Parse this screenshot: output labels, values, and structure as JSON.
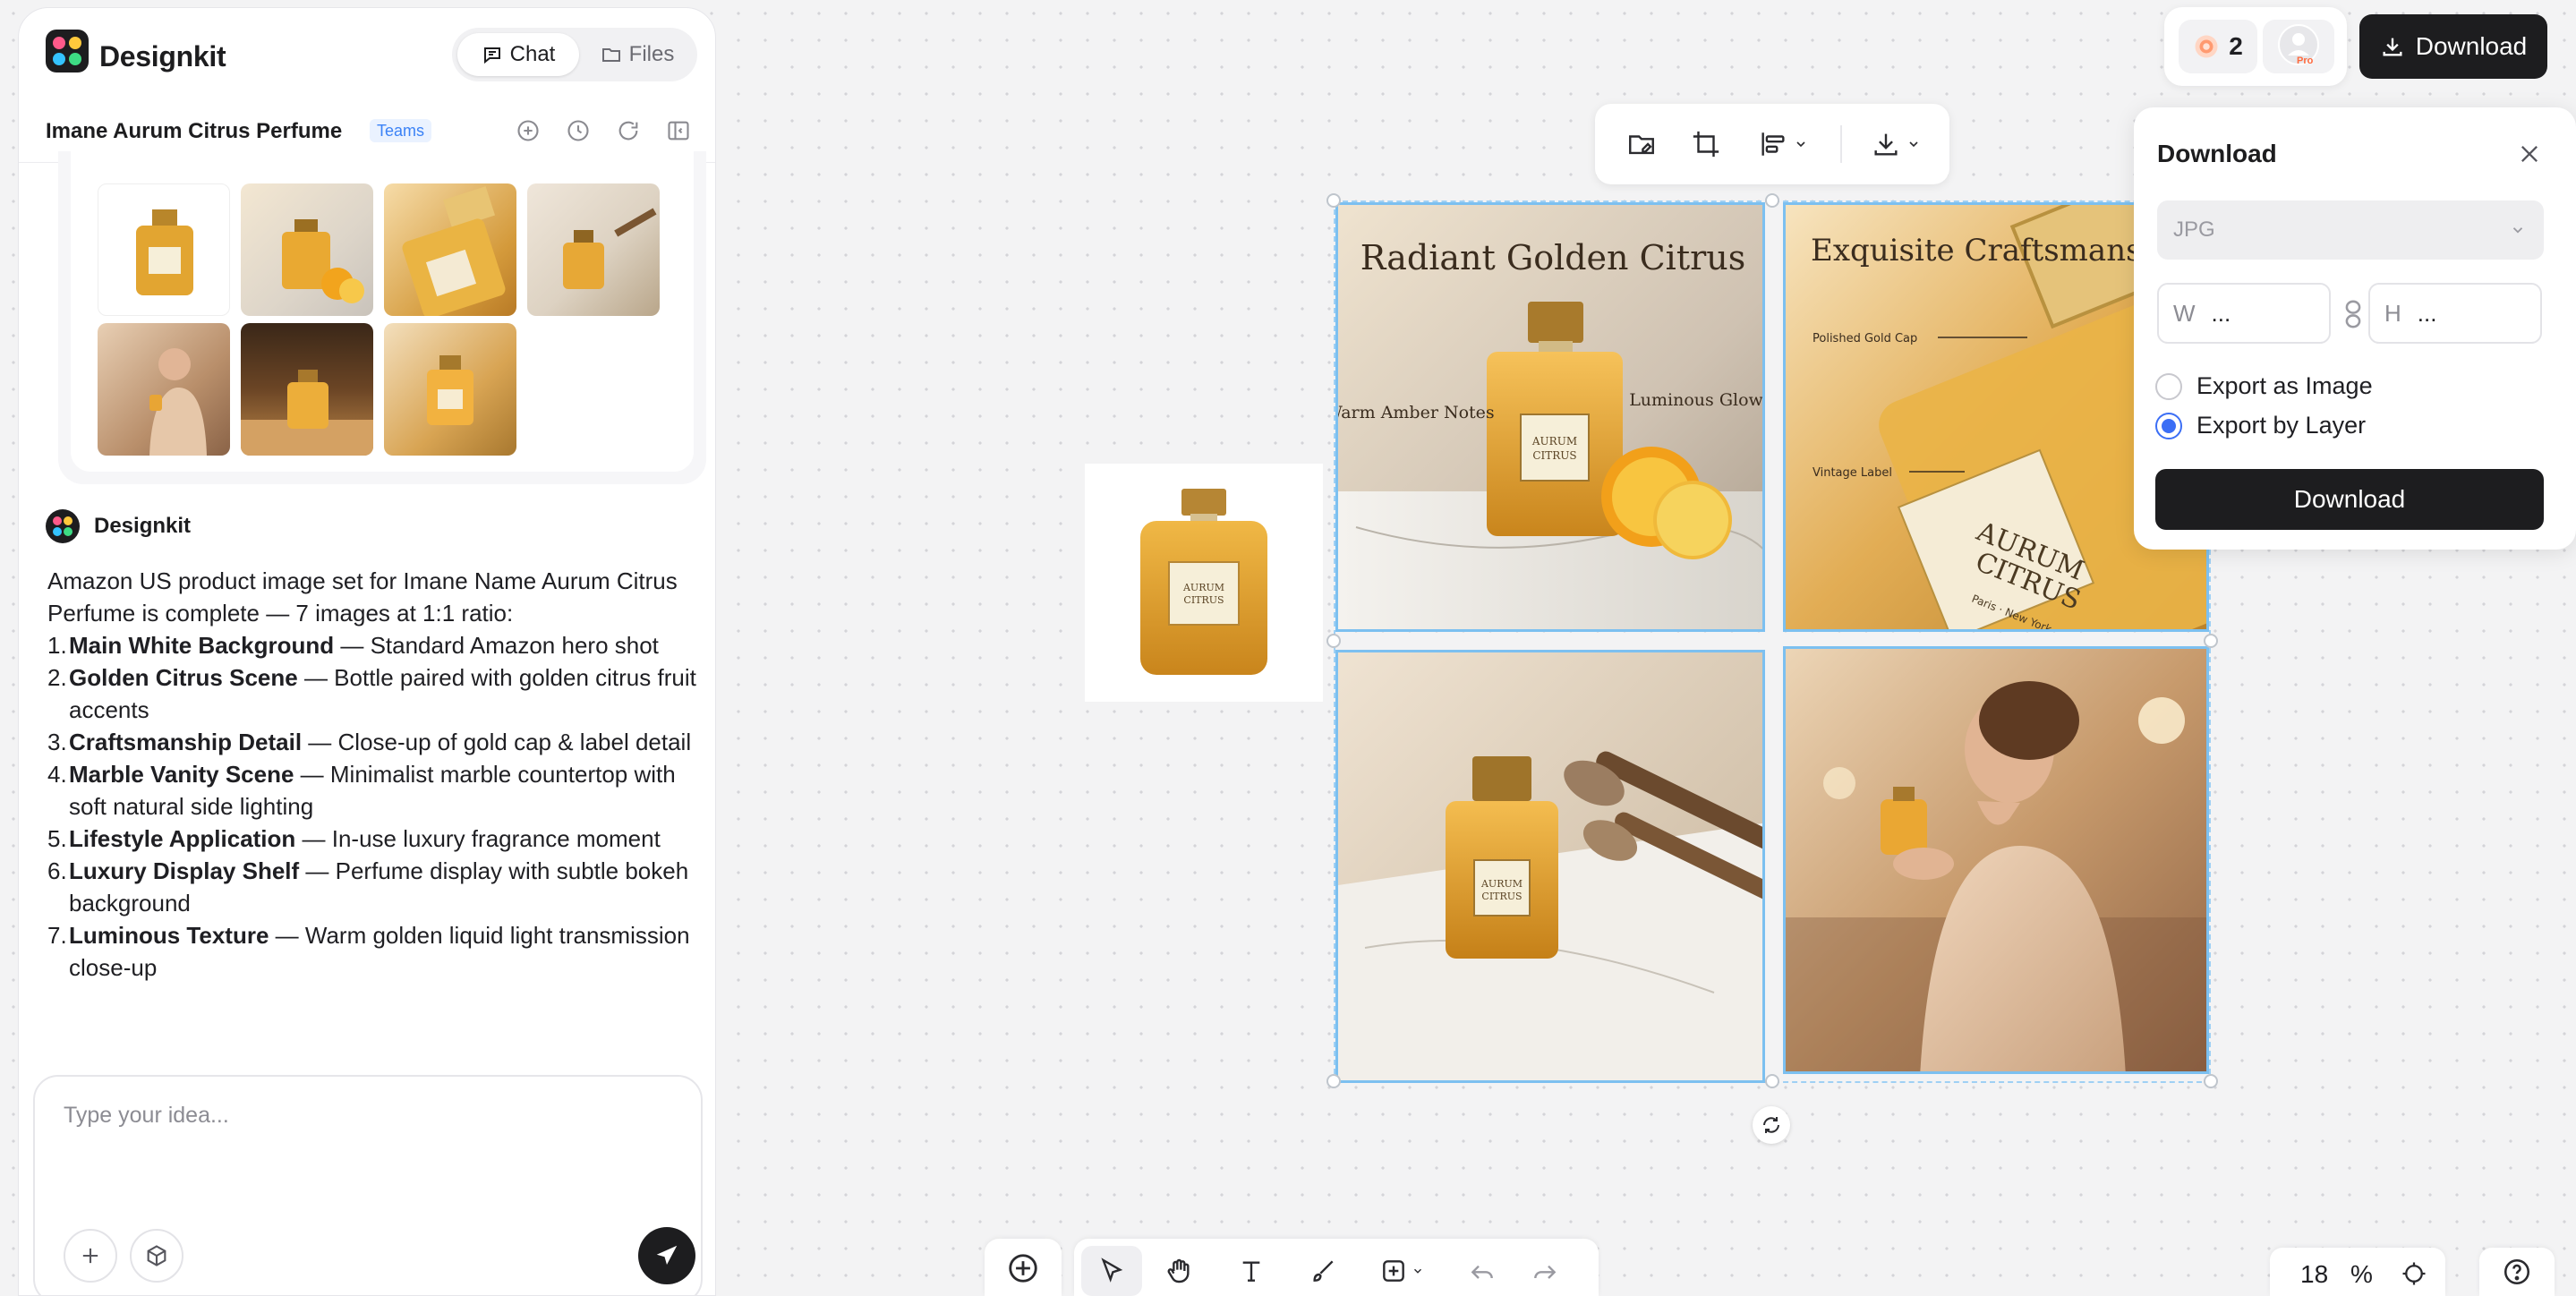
{
  "app": {
    "name": "Designkit"
  },
  "header": {
    "tabs": [
      {
        "label": "Chat",
        "active": true
      },
      {
        "label": "Files",
        "active": false
      }
    ],
    "project_title": "Imane Aurum Citrus Perfume",
    "badge": "Teams",
    "icons": [
      "add-circle-icon",
      "history-icon",
      "refresh-icon",
      "collapse-panel-icon"
    ]
  },
  "chat": {
    "sender": "Designkit",
    "intro": "Amazon US product image set for Imane Name Aurum Citrus Perfume is complete — 7 images at 1:1 ratio:",
    "items": [
      {
        "num": "1.",
        "title": "Main White Background",
        "desc": " — Standard Amazon hero shot"
      },
      {
        "num": "2.",
        "title": "Golden Citrus Scene",
        "desc": " — Bottle paired with golden citrus fruit accents"
      },
      {
        "num": "3.",
        "title": "Craftsmanship Detail",
        "desc": " — Close-up of gold cap & label detail"
      },
      {
        "num": "4.",
        "title": "Marble Vanity Scene",
        "desc": " — Minimalist marble countertop with soft natural side lighting"
      },
      {
        "num": "5.",
        "title": "Lifestyle Application",
        "desc": " — In-use luxury fragrance moment"
      },
      {
        "num": "6.",
        "title": "Luxury Display Shelf",
        "desc": " — Perfume display with subtle bokeh background"
      },
      {
        "num": "7.",
        "title": "Luminous Texture",
        "desc": " — Warm golden liquid light transmission close-up"
      }
    ]
  },
  "composer": {
    "placeholder": "Type your idea..."
  },
  "tiles": {
    "citrus": {
      "title": "Radiant Golden Citrus",
      "left_note": "Warm Amber Notes",
      "right_note": "Luminous Glow",
      "label_line1": "AURUM",
      "label_line2": "CITRUS"
    },
    "craft": {
      "title": "Exquisite Craftsmanship",
      "note1": "Polished Gold Cap",
      "note2": "Vintage Label",
      "label_line1": "AURUM",
      "label_line2": "CITRUS",
      "label_sub": "Paris · New York"
    }
  },
  "top_right": {
    "credits": "2",
    "download_label": "Download",
    "pro_badge": "Pro"
  },
  "download_panel": {
    "title": "Download",
    "format": "JPG",
    "width_label": "W",
    "width_value": "...",
    "height_label": "H",
    "height_value": "...",
    "options": [
      {
        "label": "Export as Image",
        "selected": false
      },
      {
        "label": "Export by Layer",
        "selected": true
      }
    ],
    "button": "Download"
  },
  "zoom": {
    "value": "18",
    "unit": "%"
  },
  "colors": {
    "accent": "#3b6ef5",
    "dark": "#1d1d1f",
    "selection": "#7cc0f0"
  }
}
